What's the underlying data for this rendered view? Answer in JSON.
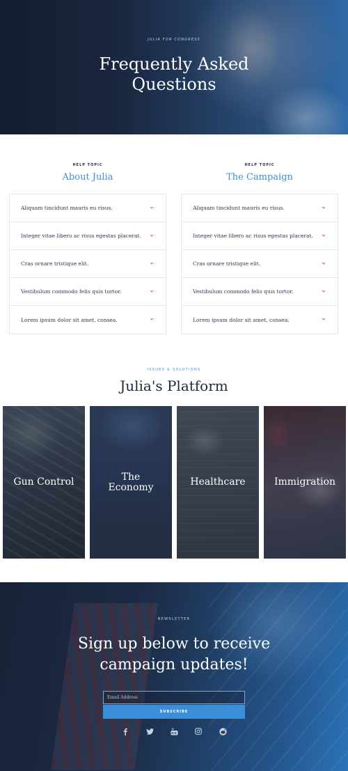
{
  "hero": {
    "kicker": "JULIA FOR CONGRESS",
    "title_line1": "Frequently Asked",
    "title_line2": "Questions"
  },
  "faq": {
    "left": {
      "kicker": "HELP TOPIC",
      "title": "About Julia",
      "items": [
        "Aliquam tincidunt mauris eu risus.",
        "Integer vitae libero ac risus egestas placerat.",
        "Cras ornare tristique elit.",
        "Vestibulum commodo felis quis tortor.",
        "Lorem ipsum dolor sit amet, consea."
      ]
    },
    "right": {
      "kicker": "HELP TOPIC",
      "title": "The Campaign",
      "items": [
        "Aliquam tincidunt mauris eu risus.",
        "Integer vitae libero ac risus egestas placerat.",
        "Cras ornare tristique elit.",
        "Vestibulum commodo felis quis tortor.",
        "Lorem ipsum dolor sit amet, consea."
      ]
    },
    "chevron_icon": "chevron-down-icon",
    "accent_color": "#e0323c"
  },
  "platform": {
    "kicker": "ISSUES & SOLUTIONS",
    "title": "Julia's Platform",
    "cards": [
      {
        "line1": "Gun Control",
        "line2": ""
      },
      {
        "line1": "The",
        "line2": "Economy"
      },
      {
        "line1": "Healthcare",
        "line2": ""
      },
      {
        "line1": "Immigration",
        "line2": ""
      }
    ]
  },
  "newsletter": {
    "kicker": "NEWSLETTER",
    "title_line1": "Sign up below to receive",
    "title_line2": "campaign updates!",
    "email_placeholder": "Email Address",
    "subscribe_label": "SUBSCRIBE",
    "social_icons": [
      "facebook-icon",
      "twitter-icon",
      "youtube-icon",
      "instagram-icon",
      "reddit-icon"
    ]
  },
  "colors": {
    "accent_blue": "#3a8fd8",
    "navy": "#1b2a44"
  }
}
